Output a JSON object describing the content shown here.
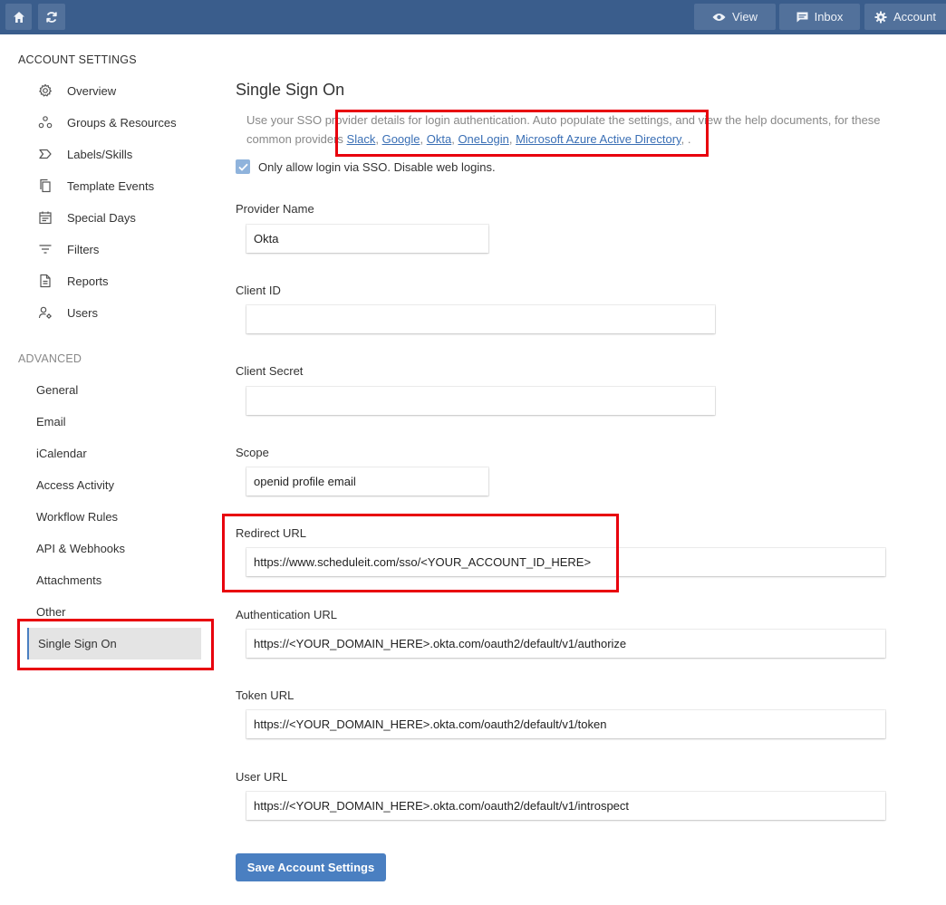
{
  "topbar": {
    "home_icon": "home-icon",
    "refresh_icon": "refresh-icon",
    "view_label": "View",
    "inbox_label": "Inbox",
    "account_label": "Account"
  },
  "sidebar": {
    "account_heading": "ACCOUNT SETTINGS",
    "account_items": [
      {
        "label": "Overview",
        "icon": "gear-icon"
      },
      {
        "label": "Groups & Resources",
        "icon": "groups-icon"
      },
      {
        "label": "Labels/Skills",
        "icon": "label-icon"
      },
      {
        "label": "Template Events",
        "icon": "copy-icon"
      },
      {
        "label": "Special Days",
        "icon": "calendar-icon"
      },
      {
        "label": "Filters",
        "icon": "filter-icon"
      },
      {
        "label": "Reports",
        "icon": "document-icon"
      },
      {
        "label": "Users",
        "icon": "user-gear-icon"
      }
    ],
    "advanced_heading": "ADVANCED",
    "advanced_items": [
      {
        "label": "General"
      },
      {
        "label": "Email"
      },
      {
        "label": "iCalendar"
      },
      {
        "label": "Access Activity"
      },
      {
        "label": "Workflow Rules"
      },
      {
        "label": "API & Webhooks"
      },
      {
        "label": "Attachments"
      },
      {
        "label": "Other"
      }
    ],
    "active_item": "Single Sign On"
  },
  "main": {
    "title": "Single Sign On",
    "description_prefix": "Use your SSO provider details for login authentication. Auto populate the settings, and view the help documents, for these common providers ",
    "providers": [
      "Slack",
      "Google",
      "Okta",
      "OneLogin",
      "Microsoft Azure Active Directory"
    ],
    "description_suffix": " .",
    "sso_only_label": "Only allow login via SSO. Disable web logins.",
    "sso_only_checked": true,
    "fields": {
      "provider_name": {
        "label": "Provider Name",
        "value": "Okta"
      },
      "client_id": {
        "label": "Client ID",
        "value": ""
      },
      "client_secret": {
        "label": "Client Secret",
        "value": ""
      },
      "scope": {
        "label": "Scope",
        "value": "openid profile email"
      },
      "redirect_url": {
        "label": "Redirect URL",
        "value": "https://www.scheduleit.com/sso/<YOUR_ACCOUNT_ID_HERE>"
      },
      "authentication_url": {
        "label": "Authentication URL",
        "value": "https://<YOUR_DOMAIN_HERE>.okta.com/oauth2/default/v1/authorize"
      },
      "token_url": {
        "label": "Token URL",
        "value": "https://<YOUR_DOMAIN_HERE>.okta.com/oauth2/default/v1/token"
      },
      "user_url": {
        "label": "User URL",
        "value": "https://<YOUR_DOMAIN_HERE>.okta.com/oauth2/default/v1/introspect"
      }
    },
    "save_label": "Save Account Settings"
  },
  "colors": {
    "topbar": "#3a5d8c",
    "accent": "#4a7fc1",
    "annotation": "#e8000d",
    "link": "#3a6fb5"
  }
}
